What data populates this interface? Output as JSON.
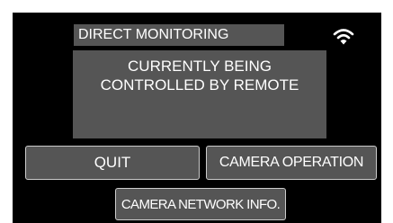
{
  "header": {
    "title": "DIRECT MONITORING",
    "wifi_icon": "wifi-icon"
  },
  "message": {
    "line1": "CURRENTLY BEING",
    "line2": "CONTROLLED BY REMOTE"
  },
  "buttons": {
    "quit": "QUIT",
    "camera_operation": "CAMERA OPERATION",
    "camera_network_info": "CAMERA NETWORK INFO."
  },
  "colors": {
    "background": "#000000",
    "panel": "#555555",
    "text": "#ffffff",
    "button_border": "#cccccc"
  }
}
